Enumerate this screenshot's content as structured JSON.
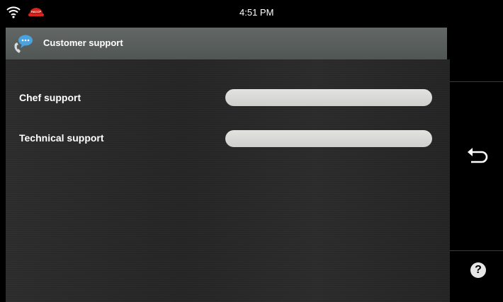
{
  "status_bar": {
    "time": "4:51 PM",
    "wifi_icon": "wifi-icon",
    "haccp_badge": "HACCP"
  },
  "header": {
    "title": "Customer support",
    "icon": "chat-phone-icon"
  },
  "form": {
    "rows": [
      {
        "label": "Chef support",
        "value": ""
      },
      {
        "label": "Technical support",
        "value": ""
      }
    ]
  },
  "sidebar": {
    "back_icon": "back-arrow-icon",
    "help_icon": "help-icon",
    "help_glyph": "?"
  },
  "colors": {
    "header_bg": "#5a605e",
    "content_bg": "#262626",
    "field_bg": "#dadad8",
    "haccp_red": "#d8261f",
    "bubble_blue": "#4aa3df"
  }
}
